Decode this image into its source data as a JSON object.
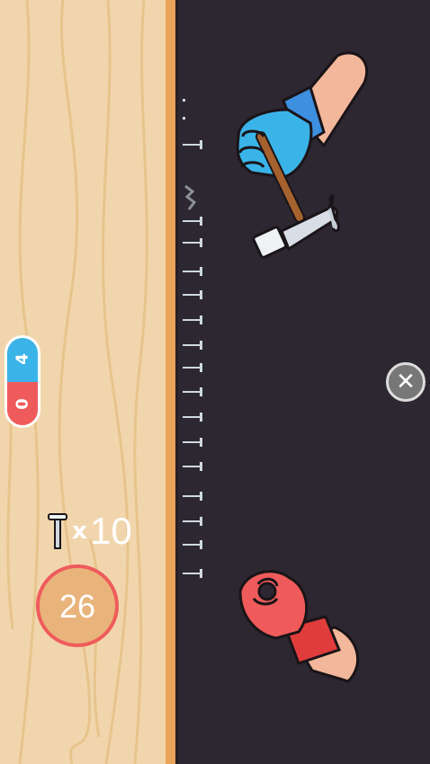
{
  "score": {
    "blue": "4",
    "red": "0"
  },
  "nails": {
    "multiplier": "x",
    "count": "10"
  },
  "timer": {
    "value": "26"
  },
  "close": {
    "label": "✕"
  },
  "colors": {
    "wood": "#f1d6ad",
    "edge": "#e9a65a",
    "table": "#2c2730",
    "blue": "#3ab4e8",
    "red": "#ef5b5b"
  },
  "icons": {
    "nail": "nail-icon",
    "hammer": "hammer-icon",
    "close": "close-icon"
  }
}
